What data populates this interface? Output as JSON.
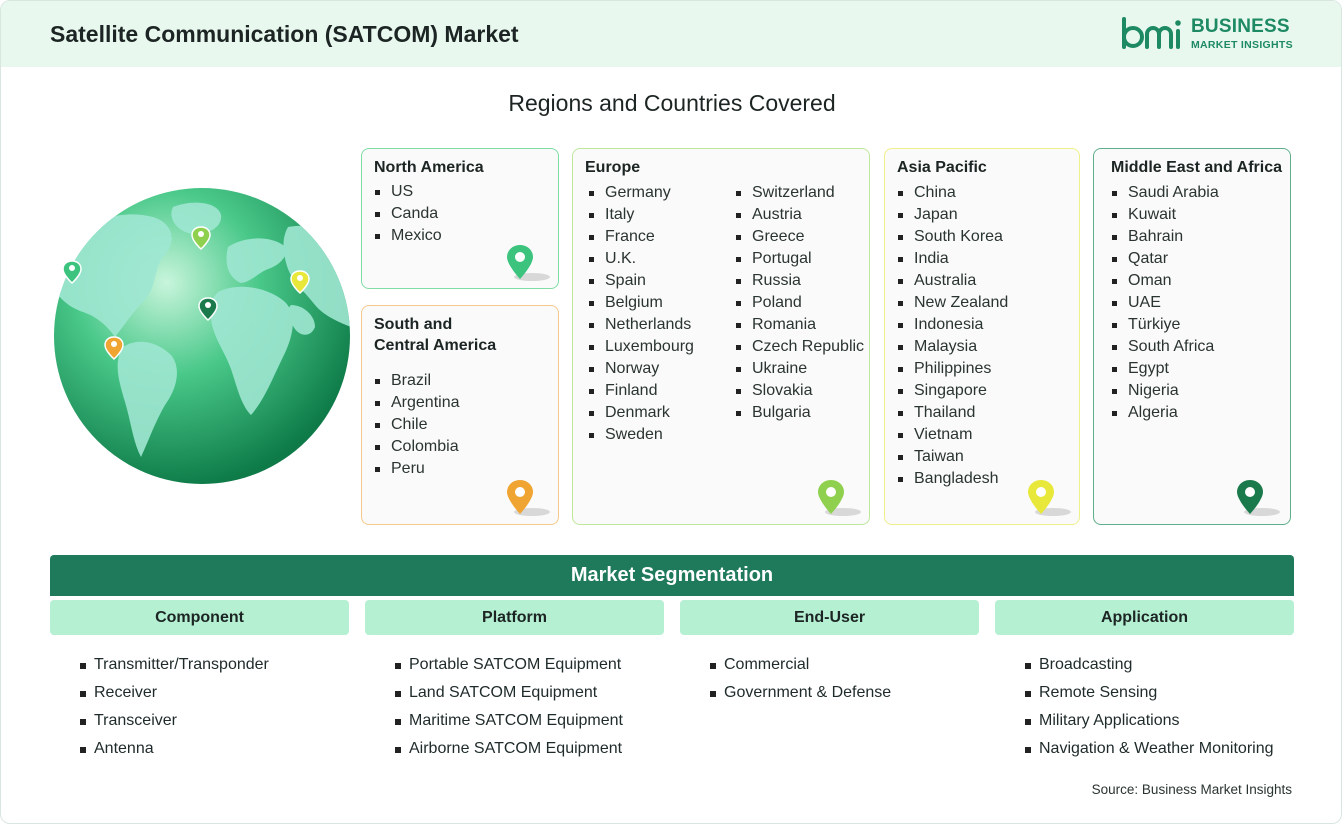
{
  "header": {
    "title": "Satellite Communication (SATCOM) Market",
    "logo_line1": "BUSINESS",
    "logo_line2": "MARKET INSIGHTS"
  },
  "regions_title": "Regions and Countries Covered",
  "regions": {
    "north_america": {
      "title": "North America",
      "items": [
        "US",
        "Canda",
        "Mexico"
      ],
      "color": "#3cc47e"
    },
    "south_america": {
      "title_line1": "South and",
      "title_line2": "Central America",
      "items": [
        "Brazil",
        "Argentina",
        "Chile",
        "Colombia",
        "Peru"
      ],
      "color": "#f0a431"
    },
    "europe": {
      "title": "Europe",
      "items_col1": [
        "Germany",
        "Italy",
        "France",
        "U.K.",
        "Spain",
        "Belgium",
        "Netherlands",
        "Luxembourg",
        "Norway",
        "Finland",
        "Denmark",
        "Sweden"
      ],
      "items_col2": [
        "Switzerland",
        "Austria",
        "Greece",
        "Portugal",
        "Russia",
        "Poland",
        "Romania",
        "Czech Republic",
        "Ukraine",
        "Slovakia",
        "Bulgaria"
      ],
      "color": "#8fd14f"
    },
    "asia_pacific": {
      "title": "Asia Pacific",
      "items": [
        "China",
        "Japan",
        "South Korea",
        "India",
        "Australia",
        "New Zealand",
        "Indonesia",
        "Malaysia",
        "Philippines",
        "Singapore",
        "Thailand",
        "Vietnam",
        "Taiwan",
        "Bangladesh"
      ],
      "color": "#e8e83a"
    },
    "mea": {
      "title": "Middle East and Africa",
      "items": [
        "Saudi Arabia",
        "Kuwait",
        "Bahrain",
        "Qatar",
        "Oman",
        "UAE",
        "Türkiye",
        "South Africa",
        "Egypt",
        "Nigeria",
        "Algeria"
      ],
      "color": "#1a7a4c"
    }
  },
  "segmentation": {
    "title": "Market Segmentation",
    "columns": [
      {
        "header": "Component",
        "items": [
          "Transmitter/Transponder",
          "Receiver",
          "Transceiver",
          "Antenna"
        ]
      },
      {
        "header": "Platform",
        "items": [
          "Portable SATCOM Equipment",
          "Land SATCOM Equipment",
          "Maritime SATCOM Equipment",
          "Airborne SATCOM Equipment"
        ]
      },
      {
        "header": "End-User",
        "items": [
          "Commercial",
          "Government & Defense"
        ]
      },
      {
        "header": "Application",
        "items": [
          "Broadcasting",
          "Remote Sensing",
          "Military Applications",
          "Navigation & Weather Monitoring"
        ]
      }
    ]
  },
  "source": "Source: Business Market Insights",
  "icons": {
    "logo": "bmi-logo-icon",
    "globe": "globe-icon",
    "pin": "location-pin-icon"
  }
}
